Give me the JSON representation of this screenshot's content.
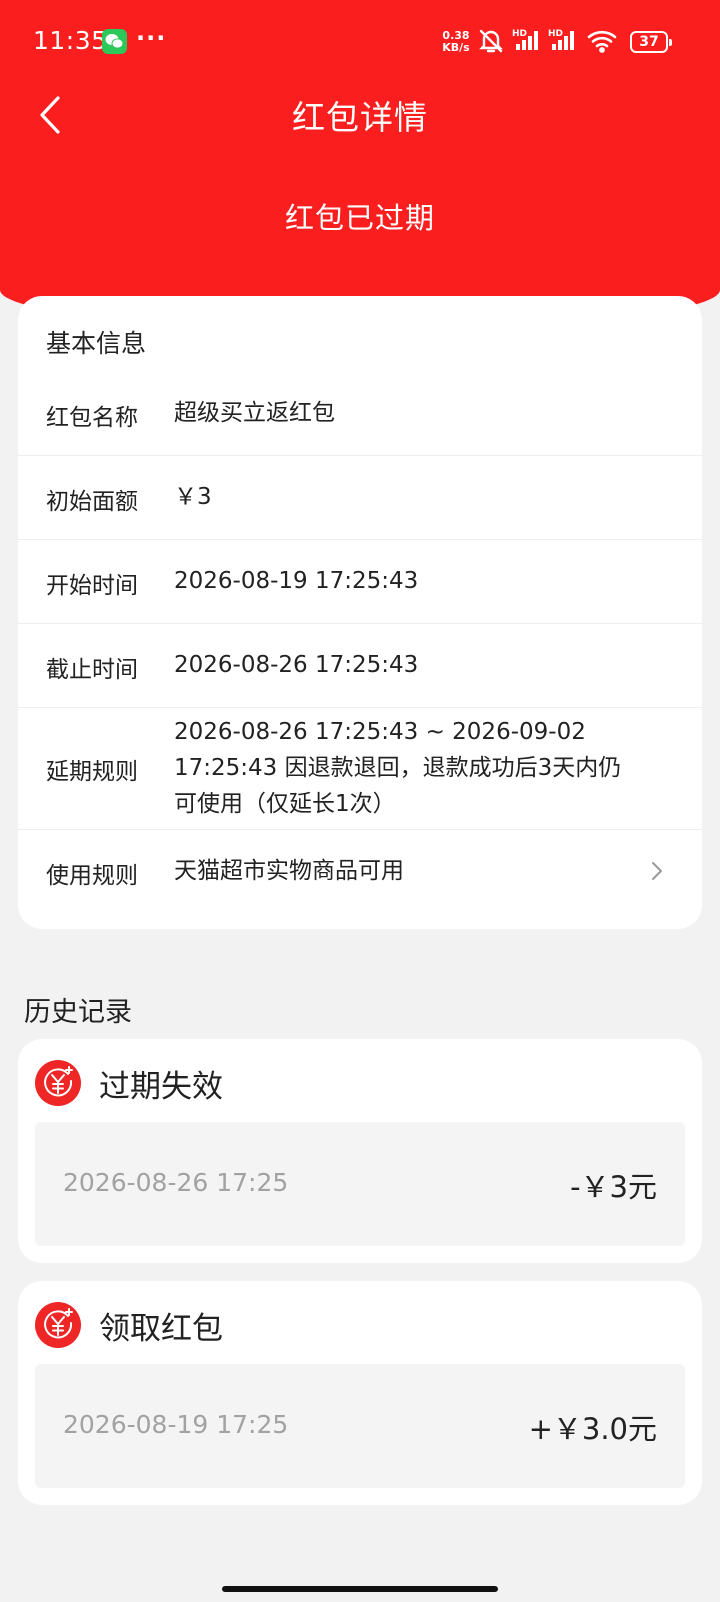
{
  "status_bar": {
    "time": "11:35",
    "more": "···",
    "net_speed_value": "0.38",
    "net_speed_unit": "KB/s",
    "signal_label": "HD",
    "battery": "37"
  },
  "nav": {
    "title": "红包详情",
    "status": "红包已过期"
  },
  "info": {
    "heading": "基本信息",
    "rows": [
      {
        "label": "红包名称",
        "value": "超级买立返红包"
      },
      {
        "label": "初始面额",
        "value": "￥3"
      },
      {
        "label": "开始时间",
        "value": "2026-08-19 17:25:43"
      },
      {
        "label": "截止时间",
        "value": "2026-08-26 17:25:43"
      },
      {
        "label": "延期规则",
        "value": "2026-08-26 17:25:43 ~ 2026-09-02 17:25:43 因退款退回，退款成功后3天内仍可使用（仅延长1次）"
      },
      {
        "label": "使用规则",
        "value": "天猫超市实物商品可用"
      }
    ]
  },
  "history": {
    "title": "历史记录",
    "records": [
      {
        "title": "过期失效",
        "date": "2026-08-26 17:25",
        "amount": "-￥3元"
      },
      {
        "title": "领取红包",
        "date": "2026-08-19 17:25",
        "amount": "+￥3.0元"
      }
    ]
  },
  "colors": {
    "brand_red": "#fb1e1e",
    "coin_red": "#ef2626",
    "date_gray": "#a2a2a2"
  }
}
